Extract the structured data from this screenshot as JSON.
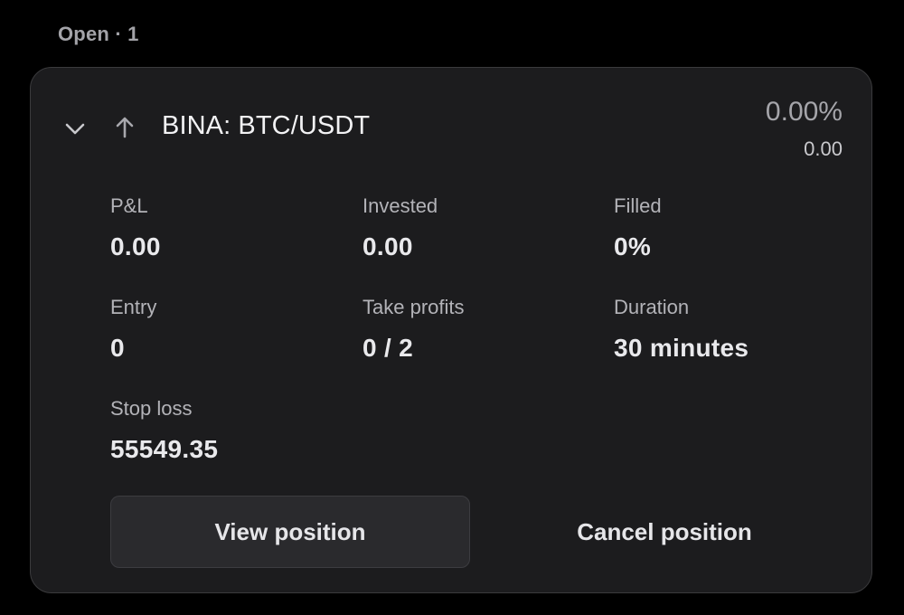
{
  "section": {
    "label": "Open · 1"
  },
  "position": {
    "pair": "BINA: BTC/USDT",
    "direction_icon": "arrow-up-icon",
    "expand_icon": "chevron-down-icon",
    "pnl_percent": "0.00%",
    "pnl_value": "0.00",
    "metrics": [
      {
        "label": "P&L",
        "value": "0.00"
      },
      {
        "label": "Invested",
        "value": "0.00"
      },
      {
        "label": "Filled",
        "value": "0%"
      },
      {
        "label": "Entry",
        "value": "0"
      },
      {
        "label": "Take profits",
        "value": "0 / 2"
      },
      {
        "label": "Duration",
        "value": "30 minutes"
      },
      {
        "label": "Stop loss",
        "value": "55549.35"
      }
    ],
    "actions": {
      "view_label": "View position",
      "cancel_label": "Cancel position"
    }
  },
  "colors": {
    "background": "#000000",
    "card": "#1c1c1e",
    "card_border": "#3a3a3c",
    "muted_text": "#a3a3a8",
    "primary_text": "#e9e9ec"
  }
}
